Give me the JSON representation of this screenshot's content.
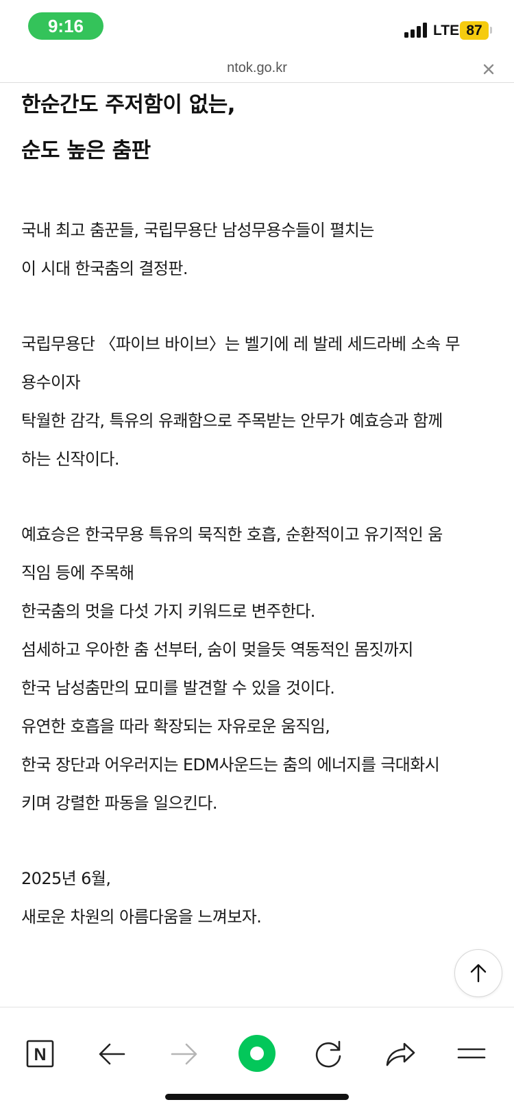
{
  "status_bar": {
    "time": "9:16",
    "network": "LTE",
    "battery": "87",
    "signal_bars": 4,
    "icons": [
      "signal-icon",
      "battery-icon"
    ]
  },
  "address_bar": {
    "url": "ntok.go.kr",
    "icons": [
      "close-icon"
    ]
  },
  "article": {
    "headline": [
      "한순간도 주저함이 없는,",
      "순도 높은 춤판"
    ],
    "paragraphs": [
      [
        "국내 최고 춤꾼들, 국립무용단 남성무용수들이 펼치는",
        "이 시대 한국춤의 결정판."
      ],
      [
        "국립무용단 〈파이브 바이브〉는 벨기에 레 발레 세드라베 소속 무",
        "용수이자",
        "탁월한 감각, 특유의 유쾌함으로 주목받는 안무가 예효승과 함께",
        "하는 신작이다."
      ],
      [
        "예효승은 한국무용 특유의 묵직한 호흡, 순환적이고 유기적인 움",
        "직임 등에 주목해",
        "한국춤의 멋을 다섯 가지 키워드로 변주한다.",
        "섬세하고 우아한 춤 선부터, 숨이 멎을듯 역동적인 몸짓까지",
        "한국 남성춤만의 묘미를 발견할 수 있을 것이다.",
        "유연한 호흡을 따라 확장되는 자유로운 움직임,",
        "한국 장단과 어우러지는 EDM사운드는 춤의 에너지를 극대화시",
        "키며 강렬한 파동을 일으킨다."
      ],
      [
        "2025년 6월,",
        "새로운 차원의 아름다움을 느껴보자."
      ]
    ]
  },
  "floating": {
    "scroll_top_icon": "arrow-up-icon"
  },
  "toolbar": {
    "items": [
      "naver-home-icon",
      "back-arrow-icon",
      "forward-arrow-icon",
      "green-dot-icon",
      "reload-icon",
      "share-icon",
      "menu-icon"
    ],
    "home_glyph": "N",
    "colors": {
      "green": "#03c75a",
      "disabled": "#b5b5b5",
      "icon": "#222222"
    }
  },
  "colors": {
    "time_pill": "#34c35a",
    "battery": "#f5cb0f"
  }
}
